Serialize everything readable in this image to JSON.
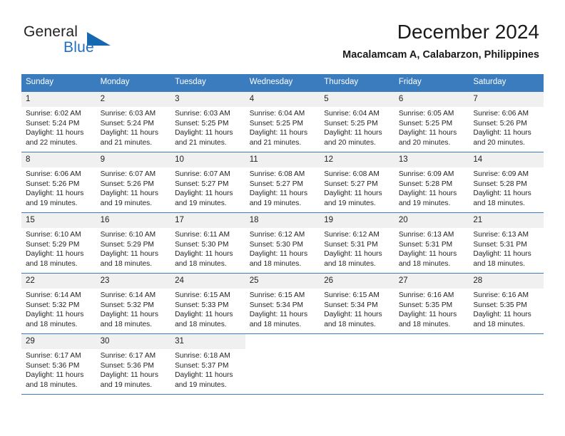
{
  "brand": {
    "name_part1": "General",
    "name_part2": "Blue",
    "logo_icon": "triangle-icon"
  },
  "header": {
    "title": "December 2024",
    "subtitle": "Macalamcam A, Calabarzon, Philippines"
  },
  "theme": {
    "accent": "#3b7cbf",
    "brand_blue": "#1f6fc0",
    "daynum_bg": "#f0f0f0",
    "text": "#231f20"
  },
  "calendar": {
    "weekdays": [
      "Sunday",
      "Monday",
      "Tuesday",
      "Wednesday",
      "Thursday",
      "Friday",
      "Saturday"
    ],
    "weeks": [
      [
        {
          "day": "1",
          "sunrise": "Sunrise: 6:02 AM",
          "sunset": "Sunset: 5:24 PM",
          "daylight": "Daylight: 11 hours and 22 minutes."
        },
        {
          "day": "2",
          "sunrise": "Sunrise: 6:03 AM",
          "sunset": "Sunset: 5:24 PM",
          "daylight": "Daylight: 11 hours and 21 minutes."
        },
        {
          "day": "3",
          "sunrise": "Sunrise: 6:03 AM",
          "sunset": "Sunset: 5:25 PM",
          "daylight": "Daylight: 11 hours and 21 minutes."
        },
        {
          "day": "4",
          "sunrise": "Sunrise: 6:04 AM",
          "sunset": "Sunset: 5:25 PM",
          "daylight": "Daylight: 11 hours and 21 minutes."
        },
        {
          "day": "5",
          "sunrise": "Sunrise: 6:04 AM",
          "sunset": "Sunset: 5:25 PM",
          "daylight": "Daylight: 11 hours and 20 minutes."
        },
        {
          "day": "6",
          "sunrise": "Sunrise: 6:05 AM",
          "sunset": "Sunset: 5:25 PM",
          "daylight": "Daylight: 11 hours and 20 minutes."
        },
        {
          "day": "7",
          "sunrise": "Sunrise: 6:06 AM",
          "sunset": "Sunset: 5:26 PM",
          "daylight": "Daylight: 11 hours and 20 minutes."
        }
      ],
      [
        {
          "day": "8",
          "sunrise": "Sunrise: 6:06 AM",
          "sunset": "Sunset: 5:26 PM",
          "daylight": "Daylight: 11 hours and 19 minutes."
        },
        {
          "day": "9",
          "sunrise": "Sunrise: 6:07 AM",
          "sunset": "Sunset: 5:26 PM",
          "daylight": "Daylight: 11 hours and 19 minutes."
        },
        {
          "day": "10",
          "sunrise": "Sunrise: 6:07 AM",
          "sunset": "Sunset: 5:27 PM",
          "daylight": "Daylight: 11 hours and 19 minutes."
        },
        {
          "day": "11",
          "sunrise": "Sunrise: 6:08 AM",
          "sunset": "Sunset: 5:27 PM",
          "daylight": "Daylight: 11 hours and 19 minutes."
        },
        {
          "day": "12",
          "sunrise": "Sunrise: 6:08 AM",
          "sunset": "Sunset: 5:27 PM",
          "daylight": "Daylight: 11 hours and 19 minutes."
        },
        {
          "day": "13",
          "sunrise": "Sunrise: 6:09 AM",
          "sunset": "Sunset: 5:28 PM",
          "daylight": "Daylight: 11 hours and 19 minutes."
        },
        {
          "day": "14",
          "sunrise": "Sunrise: 6:09 AM",
          "sunset": "Sunset: 5:28 PM",
          "daylight": "Daylight: 11 hours and 18 minutes."
        }
      ],
      [
        {
          "day": "15",
          "sunrise": "Sunrise: 6:10 AM",
          "sunset": "Sunset: 5:29 PM",
          "daylight": "Daylight: 11 hours and 18 minutes."
        },
        {
          "day": "16",
          "sunrise": "Sunrise: 6:10 AM",
          "sunset": "Sunset: 5:29 PM",
          "daylight": "Daylight: 11 hours and 18 minutes."
        },
        {
          "day": "17",
          "sunrise": "Sunrise: 6:11 AM",
          "sunset": "Sunset: 5:30 PM",
          "daylight": "Daylight: 11 hours and 18 minutes."
        },
        {
          "day": "18",
          "sunrise": "Sunrise: 6:12 AM",
          "sunset": "Sunset: 5:30 PM",
          "daylight": "Daylight: 11 hours and 18 minutes."
        },
        {
          "day": "19",
          "sunrise": "Sunrise: 6:12 AM",
          "sunset": "Sunset: 5:31 PM",
          "daylight": "Daylight: 11 hours and 18 minutes."
        },
        {
          "day": "20",
          "sunrise": "Sunrise: 6:13 AM",
          "sunset": "Sunset: 5:31 PM",
          "daylight": "Daylight: 11 hours and 18 minutes."
        },
        {
          "day": "21",
          "sunrise": "Sunrise: 6:13 AM",
          "sunset": "Sunset: 5:31 PM",
          "daylight": "Daylight: 11 hours and 18 minutes."
        }
      ],
      [
        {
          "day": "22",
          "sunrise": "Sunrise: 6:14 AM",
          "sunset": "Sunset: 5:32 PM",
          "daylight": "Daylight: 11 hours and 18 minutes."
        },
        {
          "day": "23",
          "sunrise": "Sunrise: 6:14 AM",
          "sunset": "Sunset: 5:32 PM",
          "daylight": "Daylight: 11 hours and 18 minutes."
        },
        {
          "day": "24",
          "sunrise": "Sunrise: 6:15 AM",
          "sunset": "Sunset: 5:33 PM",
          "daylight": "Daylight: 11 hours and 18 minutes."
        },
        {
          "day": "25",
          "sunrise": "Sunrise: 6:15 AM",
          "sunset": "Sunset: 5:34 PM",
          "daylight": "Daylight: 11 hours and 18 minutes."
        },
        {
          "day": "26",
          "sunrise": "Sunrise: 6:15 AM",
          "sunset": "Sunset: 5:34 PM",
          "daylight": "Daylight: 11 hours and 18 minutes."
        },
        {
          "day": "27",
          "sunrise": "Sunrise: 6:16 AM",
          "sunset": "Sunset: 5:35 PM",
          "daylight": "Daylight: 11 hours and 18 minutes."
        },
        {
          "day": "28",
          "sunrise": "Sunrise: 6:16 AM",
          "sunset": "Sunset: 5:35 PM",
          "daylight": "Daylight: 11 hours and 18 minutes."
        }
      ],
      [
        {
          "day": "29",
          "sunrise": "Sunrise: 6:17 AM",
          "sunset": "Sunset: 5:36 PM",
          "daylight": "Daylight: 11 hours and 18 minutes."
        },
        {
          "day": "30",
          "sunrise": "Sunrise: 6:17 AM",
          "sunset": "Sunset: 5:36 PM",
          "daylight": "Daylight: 11 hours and 19 minutes."
        },
        {
          "day": "31",
          "sunrise": "Sunrise: 6:18 AM",
          "sunset": "Sunset: 5:37 PM",
          "daylight": "Daylight: 11 hours and 19 minutes."
        },
        {
          "day": "",
          "sunrise": "",
          "sunset": "",
          "daylight": ""
        },
        {
          "day": "",
          "sunrise": "",
          "sunset": "",
          "daylight": ""
        },
        {
          "day": "",
          "sunrise": "",
          "sunset": "",
          "daylight": ""
        },
        {
          "day": "",
          "sunrise": "",
          "sunset": "",
          "daylight": ""
        }
      ]
    ]
  }
}
